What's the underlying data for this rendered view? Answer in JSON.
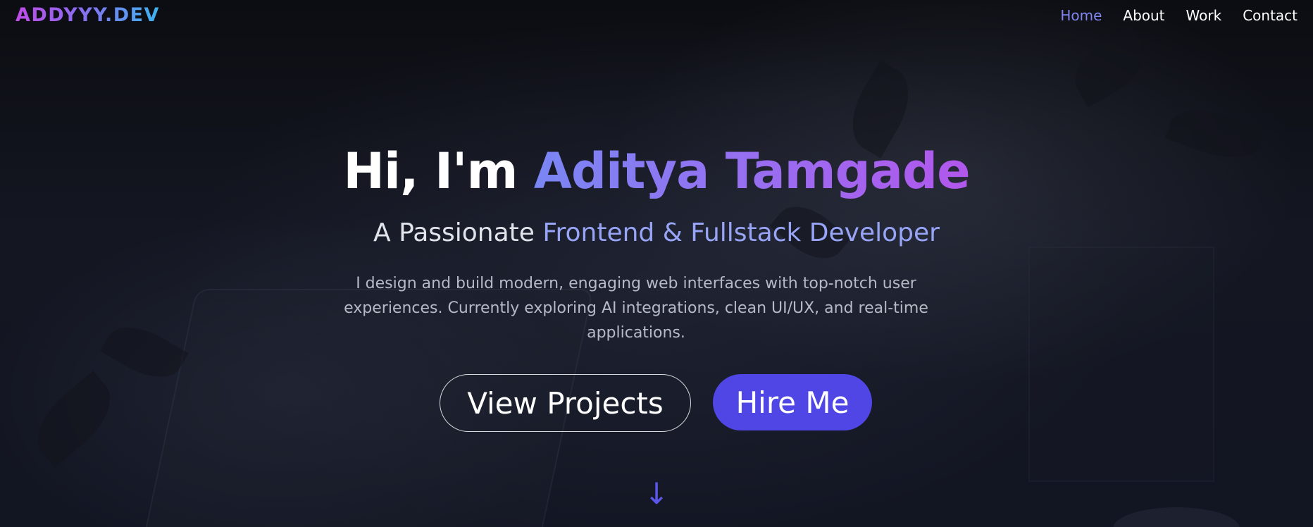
{
  "header": {
    "logo": "ADDYYY.DEV",
    "nav": [
      {
        "label": "Home",
        "active": true
      },
      {
        "label": "About",
        "active": false
      },
      {
        "label": "Work",
        "active": false
      },
      {
        "label": "Contact",
        "active": false
      }
    ]
  },
  "hero": {
    "greeting": "Hi, I'm ",
    "name": "Aditya Tamgade",
    "subtitle_prefix": "A Passionate ",
    "subtitle_role": "Frontend & Fullstack Developer",
    "description": "I design and build modern, engaging web interfaces with top-notch user experiences. Currently exploring AI integrations, clean UI/UX, and real-time applications.",
    "primary_cta": "Hire Me",
    "secondary_cta": "View Projects",
    "scroll_icon": "arrow-down-icon"
  },
  "colors": {
    "accent": "#4f46e5",
    "nav_active": "#8085f0",
    "name_gradient_start": "#7a86f4",
    "name_gradient_end": "#b257ec",
    "role_color": "#98a4f6",
    "logo_gradient_start": "#c04be8",
    "logo_gradient_end": "#3cb4f0"
  }
}
